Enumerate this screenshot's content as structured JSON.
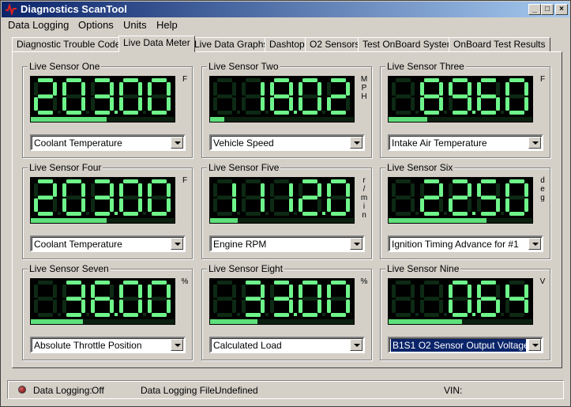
{
  "window": {
    "title": "Diagnostics ScanTool",
    "minimize_label": "_",
    "maximize_label": "□",
    "close_label": "×"
  },
  "menu": [
    "Data Logging",
    "Options",
    "Units",
    "Help"
  ],
  "tabs": [
    {
      "label": "Diagnostic Trouble Codes",
      "active": false
    },
    {
      "label": "Live Data Meter",
      "active": true
    },
    {
      "label": "Live Data Graphs",
      "active": false
    },
    {
      "label": "Dashtop",
      "active": false
    },
    {
      "label": "O2 Sensors",
      "active": false
    },
    {
      "label": "Test OnBoard System",
      "active": false
    },
    {
      "label": "OnBoard Test Results",
      "active": false
    }
  ],
  "sensors": [
    {
      "title": "Live Sensor One",
      "display": "203.00",
      "unit": "F",
      "level": 0.53,
      "selection": "Coolant Temperature",
      "selected": false
    },
    {
      "title": "Live Sensor Two",
      "display": "18.02",
      "unit": "MPH",
      "level": 0.1,
      "selection": "Vehicle Speed",
      "selected": false
    },
    {
      "title": "Live Sensor Three",
      "display": "89.60",
      "unit": "F",
      "level": 0.27,
      "selection": "Intake Air Temperature",
      "selected": false
    },
    {
      "title": "Live Sensor Four",
      "display": "203.00",
      "unit": "F",
      "level": 0.53,
      "selection": "Coolant Temperature",
      "selected": false
    },
    {
      "title": "Live Sensor Five",
      "display": "1112.0",
      "unit": "r/min",
      "level": 0.19,
      "selection": "Engine RPM",
      "selected": false
    },
    {
      "title": "Live Sensor Six",
      "display": "22.50",
      "unit": "deg",
      "level": 0.68,
      "selection": "Ignition Timing Advance for #1",
      "selected": false
    },
    {
      "title": "Live Sensor Seven",
      "display": "36.00",
      "unit": "%",
      "level": 0.36,
      "selection": "Absolute Throttle Position",
      "selected": false
    },
    {
      "title": "Live Sensor Eight",
      "display": "33.00",
      "unit": "%",
      "level": 0.33,
      "selection": "Calculated Load",
      "selected": false
    },
    {
      "title": "Live Sensor Nine",
      "display": "0.64",
      "unit": "V",
      "level": 0.51,
      "selection": "B1S1 O2 Sensor Output Voltage",
      "selected": true
    }
  ],
  "status": {
    "logging_label": "Data Logging:",
    "logging_value": "Off",
    "file_label": "Data Logging File:",
    "file_value": "Undefined",
    "vin_label": "VIN:",
    "vin_value": ""
  },
  "colors": {
    "segment_on": "#6ef58a",
    "segment_off": "#0d2a14",
    "bar_fill": "#5ee07a",
    "selection": "#0a246a",
    "led": "#9a1010"
  }
}
